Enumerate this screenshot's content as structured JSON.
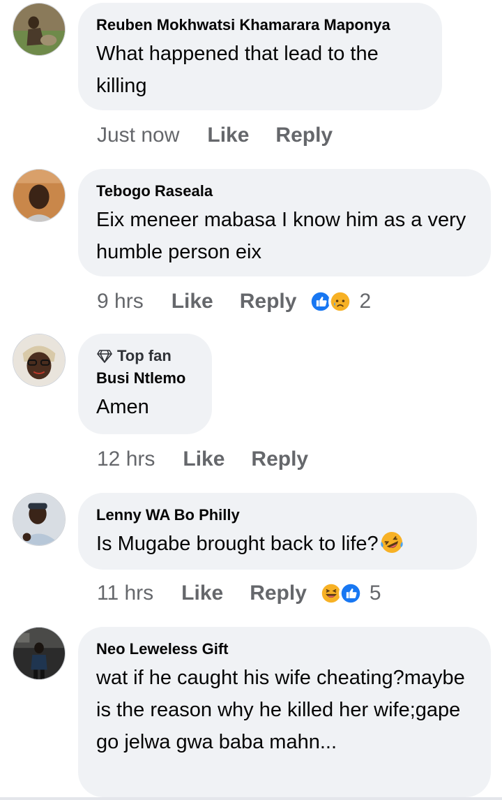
{
  "colors": {
    "bubble": "#f0f2f5",
    "meta_text": "#65676b",
    "like_blue": "#1877f2",
    "emoji_yellow": "#f7b125"
  },
  "comments": [
    {
      "author": "Reuben Mokhwatsi Khamarara Maponya",
      "text": "What happened that lead to the killing",
      "time": "Just now",
      "like": "Like",
      "reply": "Reply",
      "reactions": [],
      "reaction_count": ""
    },
    {
      "author": "Tebogo Raseala",
      "text": "Eix meneer mabasa I know him as a very humble person eix",
      "time": "9 hrs",
      "like": "Like",
      "reply": "Reply",
      "reactions": [
        "like-icon",
        "sad-icon"
      ],
      "reaction_count": "2"
    },
    {
      "badge": "Top fan",
      "badge_icon": "diamond-icon",
      "author": "Busi Ntlemo",
      "text": "Amen",
      "time": "12 hrs",
      "like": "Like",
      "reply": "Reply",
      "reactions": [],
      "reaction_count": ""
    },
    {
      "author": "Lenny WA Bo Philly",
      "text": "Is Mugabe brought back to life?",
      "text_emoji": "rolling-laughing-emoji",
      "time": "11 hrs",
      "like": "Like",
      "reply": "Reply",
      "reactions": [
        "haha-icon",
        "like-icon"
      ],
      "reaction_count": "5"
    },
    {
      "author": "Neo Leweless Gift",
      "text": "wat if he caught his wife cheating?maybe is the reason why he killed her wife;gape go jelwa gwa baba mahn...",
      "time": "",
      "like": "",
      "reply": "",
      "reactions": [],
      "reaction_count": ""
    }
  ]
}
